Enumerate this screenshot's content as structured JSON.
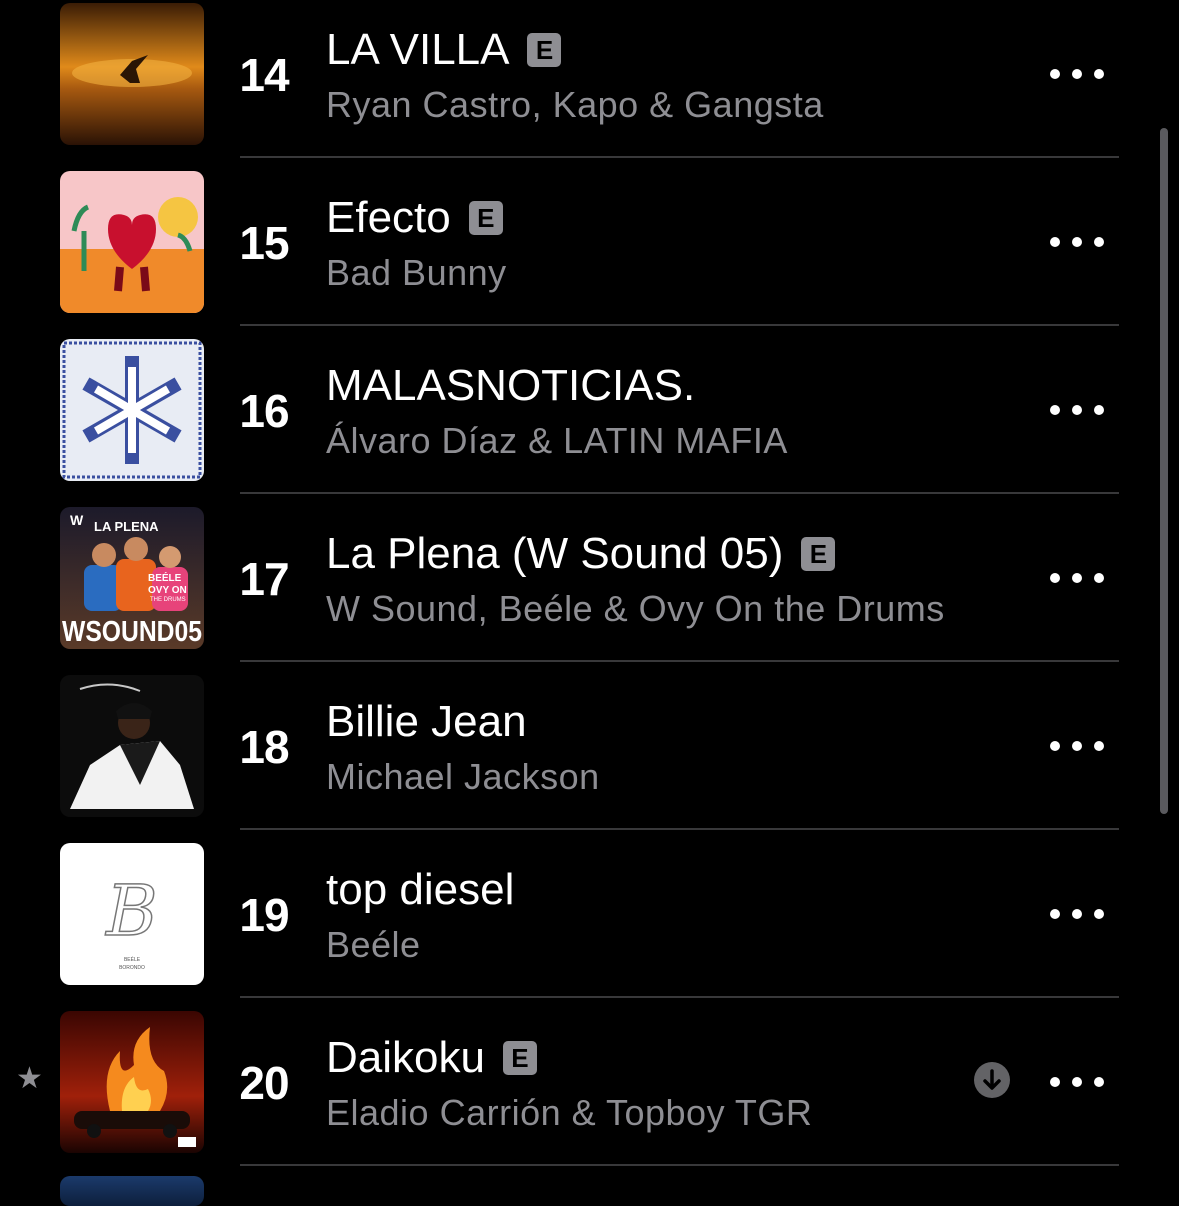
{
  "songs": [
    {
      "rank": "14",
      "title": "LA VILLA",
      "explicit": true,
      "artist": "Ryan Castro, Kapo & Gangsta"
    },
    {
      "rank": "15",
      "title": "Efecto",
      "explicit": true,
      "artist": "Bad Bunny"
    },
    {
      "rank": "16",
      "title": "MALASNOTICIAS.",
      "explicit": false,
      "artist": "Álvaro Díaz & LATIN MAFIA"
    },
    {
      "rank": "17",
      "title": "La Plena (W Sound 05)",
      "explicit": true,
      "artist": "W Sound, Beéle & Ovy On the Drums"
    },
    {
      "rank": "18",
      "title": "Billie Jean",
      "explicit": false,
      "artist": "Michael Jackson"
    },
    {
      "rank": "19",
      "title": "top diesel",
      "explicit": false,
      "artist": "Beéle"
    },
    {
      "rank": "20",
      "title": "Daikoku",
      "explicit": true,
      "artist": "Eladio Carrión & Topboy TGR"
    }
  ],
  "explicit_badge": "E",
  "album_art_text": {
    "la_plena_header": "LA PLENA",
    "la_plena_artists": "BEÉLE",
    "la_plena_ovy": "OVY ON",
    "la_plena_drums": "THE DRUMS",
    "la_plena_big": "WSOUND05",
    "top_diesel_artist": "BEÉLE",
    "top_diesel_album": "BORONDO"
  },
  "favorite_icon": "star-icon",
  "download_icon": "download-arrow-icon",
  "more_icon": "ellipsis-icon",
  "colors": {
    "background": "#000000",
    "secondary_text": "#8e8e93",
    "separator": "#38383a",
    "badge": "#8e8e93"
  }
}
